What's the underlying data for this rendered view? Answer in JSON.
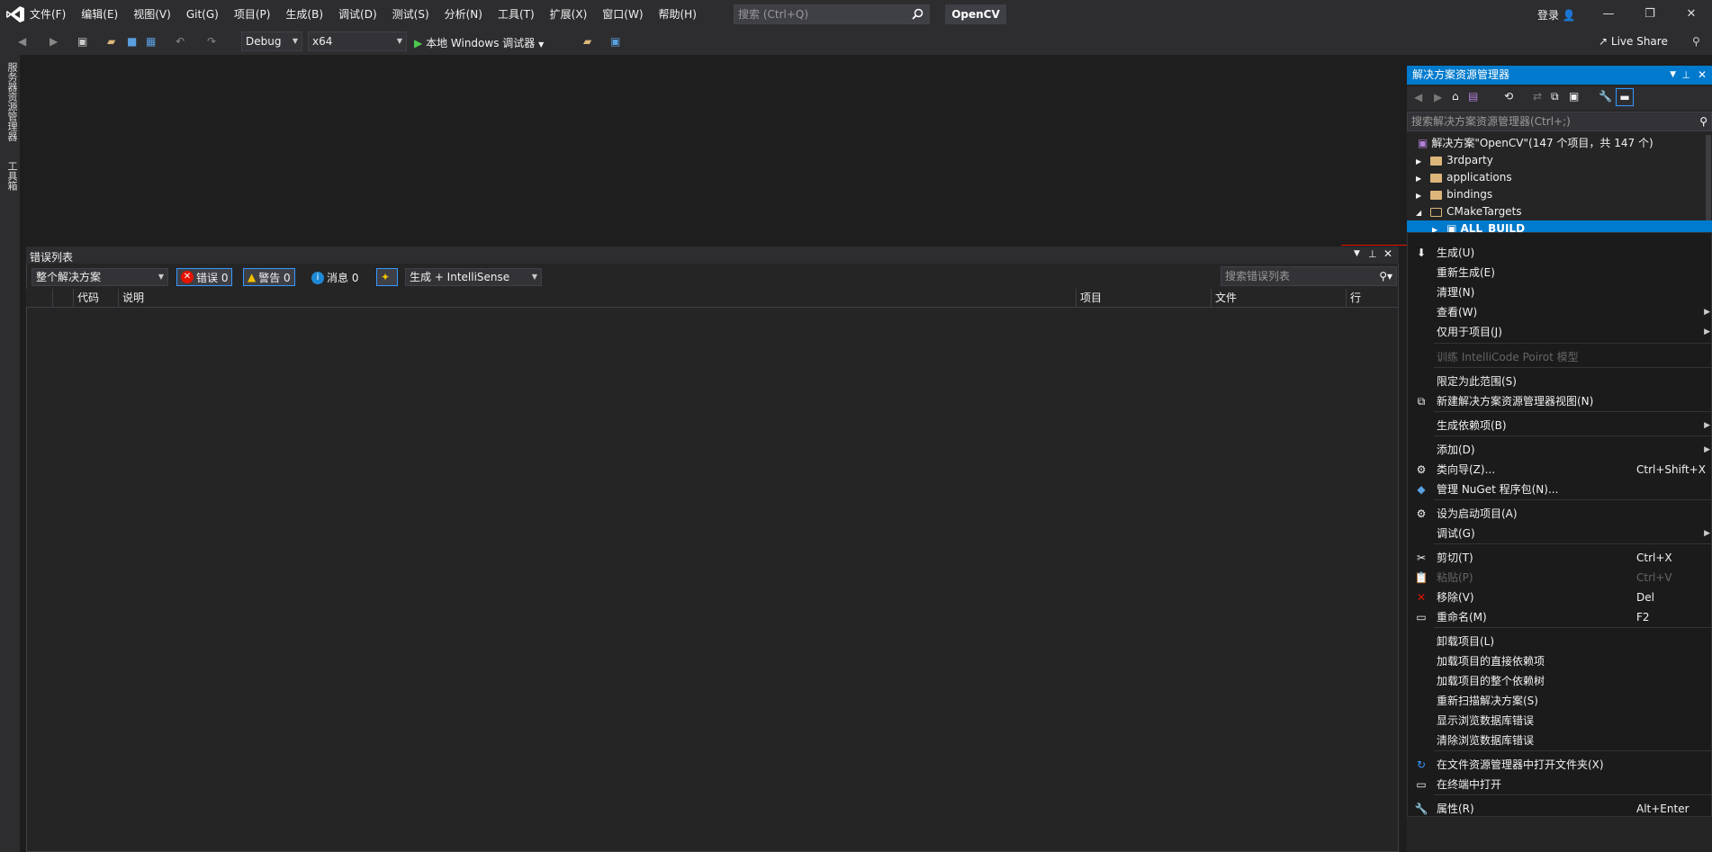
{
  "menu": [
    "文件(F)",
    "编辑(E)",
    "视图(V)",
    "Git(G)",
    "项目(P)",
    "生成(B)",
    "调试(D)",
    "测试(S)",
    "分析(N)",
    "工具(T)",
    "扩展(X)",
    "窗口(W)",
    "帮助(H)"
  ],
  "search": {
    "placeholder": "搜索 (Ctrl+Q)"
  },
  "app_title": "OpenCV",
  "login": "登录",
  "window_controls": {
    "minimize": "—",
    "maximize": "❐",
    "close": "✕"
  },
  "toolbar": {
    "config": "Debug",
    "platform": "x64",
    "run_label": "本地 Windows 调试器",
    "live_share": "Live Share"
  },
  "left_sidebar": {
    "server_explorer": "服务器资源管理器",
    "toolbox": "工具箱"
  },
  "error_list": {
    "title": "错误列表",
    "scope": "整个解决方案",
    "errors": "错误 0",
    "warnings": "警告 0",
    "messages": "消息 0",
    "build_filter": "生成 + IntelliSense",
    "search_placeholder": "搜索错误列表",
    "columns": {
      "code": "代码",
      "desc": "说明",
      "project": "项目",
      "file": "文件",
      "line": "行"
    }
  },
  "solution_explorer": {
    "title": "解决方案资源管理器",
    "search_placeholder": "搜索解决方案资源管理器(Ctrl+;)",
    "tree": [
      {
        "label": "解决方案\"OpenCV\"(147 个项目，共 147 个)"
      },
      {
        "label": "3rdparty"
      },
      {
        "label": "applications"
      },
      {
        "label": "bindings"
      },
      {
        "label": "CMakeTargets"
      },
      {
        "label": "ALL_BUILD"
      }
    ]
  },
  "context_menu": {
    "items": [
      {
        "label": "生成(U)",
        "shortcut": "",
        "icon": "build-icon",
        "sub": false,
        "disabled": false
      },
      {
        "label": "重新生成(E)",
        "shortcut": "",
        "icon": "",
        "sub": false,
        "disabled": false
      },
      {
        "label": "清理(N)",
        "shortcut": "",
        "icon": "",
        "sub": false,
        "disabled": false
      },
      {
        "label": "查看(W)",
        "shortcut": "",
        "icon": "",
        "sub": true,
        "disabled": false
      },
      {
        "label": "仅用于项目(J)",
        "shortcut": "",
        "icon": "",
        "sub": true,
        "disabled": false
      },
      {
        "label": "训练 IntelliCode Poirot 模型",
        "shortcut": "",
        "icon": "",
        "sub": false,
        "disabled": true
      },
      {
        "label": "限定为此范围(S)",
        "shortcut": "",
        "icon": "",
        "sub": false,
        "disabled": false
      },
      {
        "label": "新建解决方案资源管理器视图(N)",
        "shortcut": "",
        "icon": "new-view-icon",
        "sub": false,
        "disabled": false
      },
      {
        "label": "生成依赖项(B)",
        "shortcut": "",
        "icon": "",
        "sub": true,
        "disabled": false
      },
      {
        "label": "添加(D)",
        "shortcut": "",
        "icon": "",
        "sub": true,
        "disabled": false
      },
      {
        "label": "类向导(Z)...",
        "shortcut": "Ctrl+Shift+X",
        "icon": "class-wizard-icon",
        "sub": false,
        "disabled": false
      },
      {
        "label": "管理 NuGet 程序包(N)...",
        "shortcut": "",
        "icon": "nuget-icon",
        "sub": false,
        "disabled": false
      },
      {
        "label": "设为启动项目(A)",
        "shortcut": "",
        "icon": "gear-icon",
        "sub": false,
        "disabled": false
      },
      {
        "label": "调试(G)",
        "shortcut": "",
        "icon": "",
        "sub": true,
        "disabled": false
      },
      {
        "label": "剪切(T)",
        "shortcut": "Ctrl+X",
        "icon": "cut-icon",
        "sub": false,
        "disabled": false
      },
      {
        "label": "粘贴(P)",
        "shortcut": "Ctrl+V",
        "icon": "paste-icon",
        "sub": false,
        "disabled": true
      },
      {
        "label": "移除(V)",
        "shortcut": "Del",
        "icon": "remove-icon",
        "sub": false,
        "disabled": false
      },
      {
        "label": "重命名(M)",
        "shortcut": "F2",
        "icon": "rename-icon",
        "sub": false,
        "disabled": false
      },
      {
        "label": "卸载项目(L)",
        "shortcut": "",
        "icon": "",
        "sub": false,
        "disabled": false
      },
      {
        "label": "加载项目的直接依赖项",
        "shortcut": "",
        "icon": "",
        "sub": false,
        "disabled": false
      },
      {
        "label": "加载项目的整个依赖树",
        "shortcut": "",
        "icon": "",
        "sub": false,
        "disabled": false
      },
      {
        "label": "重新扫描解决方案(S)",
        "shortcut": "",
        "icon": "",
        "sub": false,
        "disabled": false
      },
      {
        "label": "显示浏览数据库错误",
        "shortcut": "",
        "icon": "",
        "sub": false,
        "disabled": false
      },
      {
        "label": "清除浏览数据库错误",
        "shortcut": "",
        "icon": "",
        "sub": false,
        "disabled": false
      },
      {
        "label": "在文件资源管理器中打开文件夹(X)",
        "shortcut": "",
        "icon": "open-folder-icon",
        "sub": false,
        "disabled": false
      },
      {
        "label": "在终端中打开",
        "shortcut": "",
        "icon": "terminal-icon",
        "sub": false,
        "disabled": false
      },
      {
        "label": "属性(R)",
        "shortcut": "Alt+Enter",
        "icon": "wrench-icon",
        "sub": false,
        "disabled": false
      }
    ]
  },
  "colors": {
    "accent": "#007acc",
    "bg": "#1e1e1e",
    "panel": "#252526",
    "chrome": "#2d2d30"
  }
}
